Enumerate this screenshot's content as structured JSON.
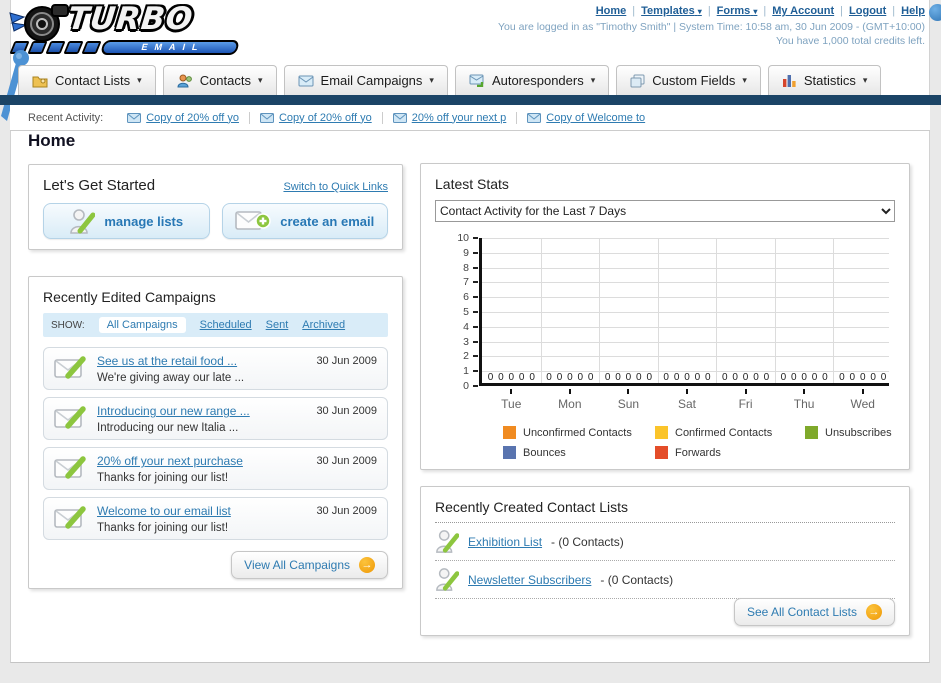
{
  "app_name": "Turbo Email",
  "colors": {
    "navy_bar": "#1b4466",
    "link_blue": "#2e7bb1",
    "accent_orange": "#f09a0c",
    "pencil_green": "#8dc63f"
  },
  "logo": {
    "word": "TURBO",
    "sub": "EMAIL"
  },
  "header": {
    "links": [
      {
        "label": "Home"
      },
      {
        "label": "Templates"
      },
      {
        "label": "Forms"
      },
      {
        "label": "My Account"
      },
      {
        "label": "Logout"
      },
      {
        "label": "Help"
      }
    ],
    "status_line": "You are logged in as \"Timothy Smith\" | System Time: 10:58 am, 30 Jun 2009 - (GMT+10:00)",
    "credits_line": "You have 1,000 total credits left."
  },
  "tabs": [
    {
      "label": "Contact Lists"
    },
    {
      "label": "Contacts"
    },
    {
      "label": "Email Campaigns"
    },
    {
      "label": "Autoresponders"
    },
    {
      "label": "Custom Fields"
    },
    {
      "label": "Statistics"
    }
  ],
  "recent_activity": {
    "label": "Recent Activity:",
    "items": [
      {
        "label": "Copy of 20% off yo"
      },
      {
        "label": "Copy of 20% off yo"
      },
      {
        "label": "20% off your next p"
      },
      {
        "label": "Copy of Welcome to"
      }
    ]
  },
  "page_title": "Home",
  "get_started": {
    "title": "Let's Get Started",
    "switch_link": "Switch to Quick Links",
    "manage_lists_label": "manage lists",
    "create_email_label": "create an email"
  },
  "campaigns": {
    "title": "Recently Edited Campaigns",
    "show_label": "SHOW:",
    "filters": [
      {
        "label": "All Campaigns",
        "active": true
      },
      {
        "label": "Scheduled",
        "active": false
      },
      {
        "label": "Sent",
        "active": false
      },
      {
        "label": "Archived",
        "active": false
      }
    ],
    "items": [
      {
        "title": "See us at the retail food ...",
        "subtitle": "We're giving away our late ...",
        "date": "30 Jun 2009"
      },
      {
        "title": "Introducing our new range ...",
        "subtitle": "Introducing our new Italia ...",
        "date": "30 Jun 2009"
      },
      {
        "title": "20% off your next purchase",
        "subtitle": "Thanks for joining our list!",
        "date": "30 Jun 2009"
      },
      {
        "title": "Welcome to our email list",
        "subtitle": "Thanks for joining our list!",
        "date": "30 Jun 2009"
      }
    ],
    "view_all_label": "View All Campaigns"
  },
  "latest_stats": {
    "title": "Latest Stats",
    "period_selector": "Contact Activity for the Last 7 Days",
    "chart_data": {
      "type": "bar",
      "title": "Contact Activity for the Last 7 Days",
      "categories": [
        "Tue",
        "Mon",
        "Sun",
        "Sat",
        "Fri",
        "Thu",
        "Wed"
      ],
      "series": [
        {
          "name": "Unconfirmed Contacts",
          "color": "#f08b21",
          "values": [
            0,
            0,
            0,
            0,
            0,
            0,
            0
          ]
        },
        {
          "name": "Confirmed Contacts",
          "color": "#fbc42a",
          "values": [
            0,
            0,
            0,
            0,
            0,
            0,
            0
          ]
        },
        {
          "name": "Unsubscribes",
          "color": "#7fa92b",
          "values": [
            0,
            0,
            0,
            0,
            0,
            0,
            0
          ]
        },
        {
          "name": "Bounces",
          "color": "#5974af",
          "values": [
            0,
            0,
            0,
            0,
            0,
            0,
            0
          ]
        },
        {
          "name": "Forwards",
          "color": "#e44d29",
          "values": [
            0,
            0,
            0,
            0,
            0,
            0,
            0
          ]
        }
      ],
      "ylim": [
        0,
        10
      ],
      "ytick_step": 1,
      "grid": true,
      "legend_position": "bottom",
      "bar_value_label": "0"
    }
  },
  "contact_lists": {
    "title": "Recently Created Contact Lists",
    "items": [
      {
        "name": "Exhibition List",
        "detail": "- (0 Contacts)"
      },
      {
        "name": "Newsletter Subscribers",
        "detail": "- (0 Contacts)"
      }
    ],
    "see_all_label": "See All Contact Lists"
  }
}
